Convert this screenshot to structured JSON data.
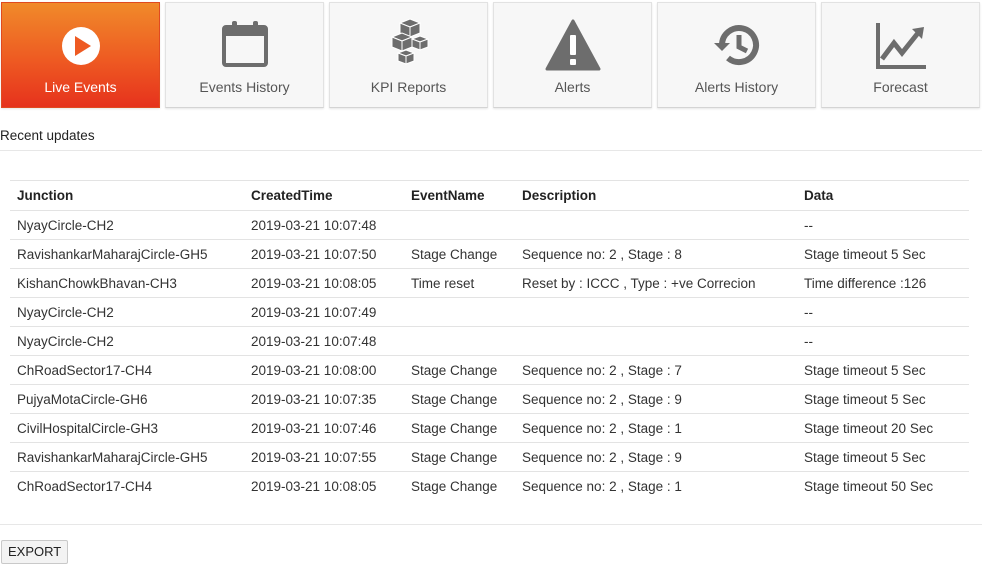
{
  "tabs": [
    {
      "label": "Live Events",
      "icon": "play-circle-icon",
      "active": true
    },
    {
      "label": "Events History",
      "icon": "calendar-icon",
      "active": false
    },
    {
      "label": "KPI Reports",
      "icon": "cubes-icon",
      "active": false
    },
    {
      "label": "Alerts",
      "icon": "warning-icon",
      "active": false
    },
    {
      "label": "Alerts History",
      "icon": "history-icon",
      "active": false
    },
    {
      "label": "Forecast",
      "icon": "line-chart-icon",
      "active": false
    }
  ],
  "colors": {
    "active_tab_top": "#f08a2a",
    "active_tab_bottom": "#e6321d",
    "icon_gray": "#6d6d6d"
  },
  "section_title": "Recent updates",
  "table": {
    "headers": [
      "Junction",
      "CreatedTime",
      "EventName",
      "Description",
      "Data"
    ],
    "rows": [
      [
        "NyayCircle-CH2",
        "2019-03-21 10:07:48",
        "",
        "",
        "--"
      ],
      [
        "RavishankarMaharajCircle-GH5",
        "2019-03-21 10:07:50",
        "Stage Change",
        "Sequence no: 2 , Stage : 8",
        "Stage timeout 5 Sec"
      ],
      [
        "KishanChowkBhavan-CH3",
        "2019-03-21 10:08:05",
        "Time reset",
        "Reset by : ICCC , Type : +ve Correcion",
        "Time difference :126"
      ],
      [
        "NyayCircle-CH2",
        "2019-03-21 10:07:49",
        "",
        "",
        "--"
      ],
      [
        "NyayCircle-CH2",
        "2019-03-21 10:07:48",
        "",
        "",
        "--"
      ],
      [
        "ChRoadSector17-CH4",
        "2019-03-21 10:08:00",
        "Stage Change",
        "Sequence no: 2 , Stage : 7",
        "Stage timeout 5 Sec"
      ],
      [
        "PujyaMotaCircle-GH6",
        "2019-03-21 10:07:35",
        "Stage Change",
        "Sequence no: 2 , Stage : 9",
        "Stage timeout 5 Sec"
      ],
      [
        "CivilHospitalCircle-GH3",
        "2019-03-21 10:07:46",
        "Stage Change",
        "Sequence no: 2 , Stage : 1",
        "Stage timeout 20 Sec"
      ],
      [
        "RavishankarMaharajCircle-GH5",
        "2019-03-21 10:07:55",
        "Stage Change",
        "Sequence no: 2 , Stage : 9",
        "Stage timeout 5 Sec"
      ],
      [
        "ChRoadSector17-CH4",
        "2019-03-21 10:08:05",
        "Stage Change",
        "Sequence no: 2 , Stage : 1",
        "Stage timeout 50 Sec"
      ]
    ]
  },
  "export_label": "EXPORT"
}
